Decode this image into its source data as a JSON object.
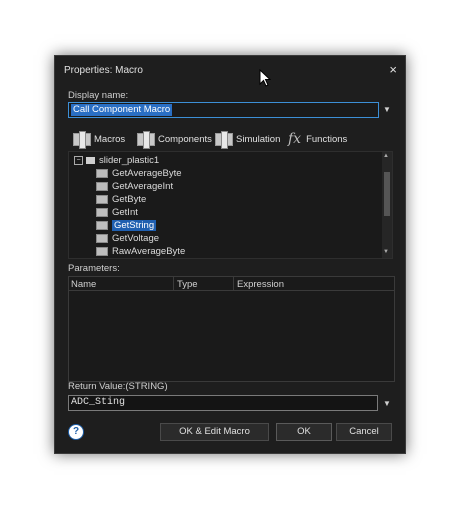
{
  "dialog": {
    "title": "Properties: Macro",
    "close_glyph": "×"
  },
  "display_name": {
    "label": "Display name:",
    "value": "Call Component Macro"
  },
  "tabs": [
    {
      "label": "Macros",
      "icon": "component-icon"
    },
    {
      "label": "Components",
      "icon": "component-icon"
    },
    {
      "label": "Simulation",
      "icon": "component-icon"
    },
    {
      "label": "Functions",
      "icon": "fx-icon"
    }
  ],
  "tree": {
    "root": {
      "label": "slider_plastic1",
      "expander": "−"
    },
    "items": [
      {
        "label": "GetAverageByte"
      },
      {
        "label": "GetAverageInt"
      },
      {
        "label": "GetByte"
      },
      {
        "label": "GetInt"
      },
      {
        "label": "GetString",
        "selected": true
      },
      {
        "label": "GetVoltage"
      },
      {
        "label": "RawAverageByte"
      }
    ]
  },
  "parameters": {
    "label": "Parameters:",
    "columns": [
      "Name",
      "Type",
      "Expression"
    ]
  },
  "return_value": {
    "label": "Return Value:(STRING)",
    "value": "ADC_Sting"
  },
  "buttons": {
    "help": "?",
    "ok_edit": "OK & Edit Macro",
    "ok": "OK",
    "cancel": "Cancel"
  }
}
